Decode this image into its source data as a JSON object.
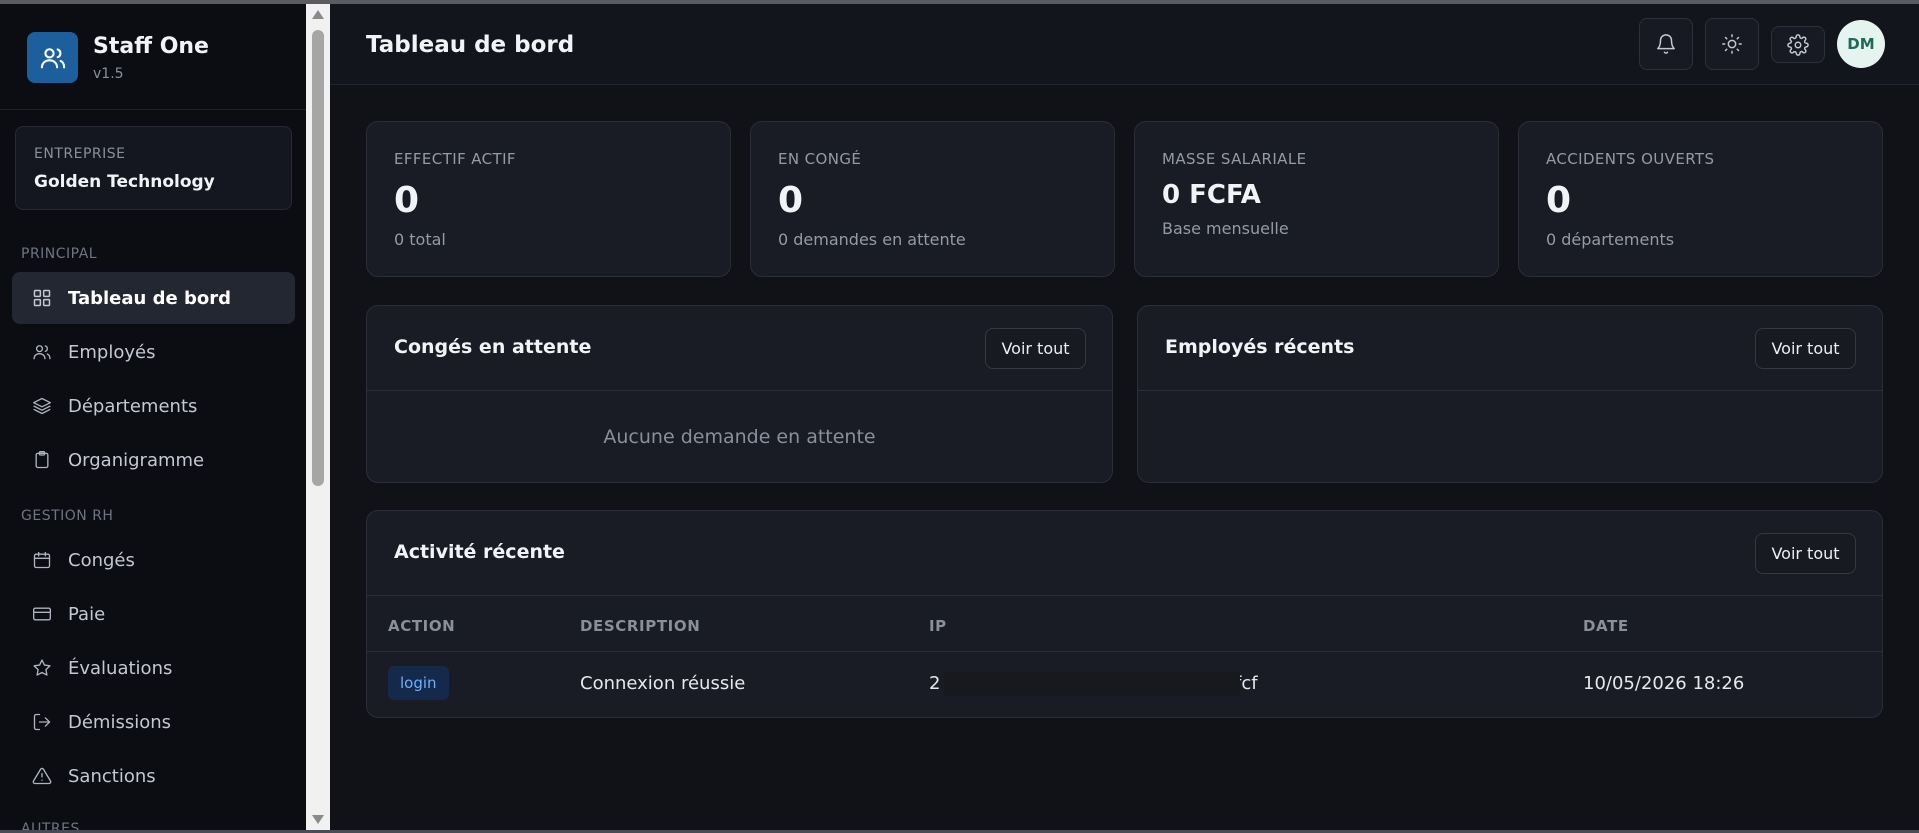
{
  "app": {
    "name": "Staff One",
    "version": "v1.5"
  },
  "company": {
    "label": "ENTREPRISE",
    "name": "Golden Technology"
  },
  "sidebar": {
    "sections": [
      {
        "label": "PRINCIPAL",
        "items": [
          {
            "label": "Tableau de bord",
            "icon": "grid-icon",
            "active": true
          },
          {
            "label": "Employés",
            "icon": "users-icon"
          },
          {
            "label": "Départements",
            "icon": "layers-icon"
          },
          {
            "label": "Organigramme",
            "icon": "clipboard-icon"
          }
        ]
      },
      {
        "label": "GESTION RH",
        "items": [
          {
            "label": "Congés",
            "icon": "calendar-icon"
          },
          {
            "label": "Paie",
            "icon": "credit-card-icon"
          },
          {
            "label": "Évaluations",
            "icon": "star-icon"
          },
          {
            "label": "Démissions",
            "icon": "logout-icon"
          },
          {
            "label": "Sanctions",
            "icon": "alert-triangle-icon"
          }
        ]
      },
      {
        "label": "AUTRES",
        "items": []
      }
    ]
  },
  "header": {
    "title": "Tableau de bord",
    "avatar_initials": "DM"
  },
  "stats": [
    {
      "label": "EFFECTIF ACTIF",
      "value": "0",
      "sub": "0 total"
    },
    {
      "label": "EN CONGÉ",
      "value": "0",
      "sub": "0 demandes en attente"
    },
    {
      "label": "MASSE SALARIALE",
      "value": "0 FCFA",
      "sub": "Base mensuelle"
    },
    {
      "label": "ACCIDENTS OUVERTS",
      "value": "0",
      "sub": "0 départements"
    }
  ],
  "panels": {
    "leaves": {
      "title": "Congés en attente",
      "button": "Voir tout",
      "empty": "Aucune demande en attente"
    },
    "recent_employees": {
      "title": "Employés récents",
      "button": "Voir tout"
    },
    "activity": {
      "title": "Activité récente",
      "button": "Voir tout"
    }
  },
  "activity_table": {
    "columns": [
      "ACTION",
      "DESCRIPTION",
      "IP",
      "DATE"
    ],
    "rows": [
      {
        "action": "login",
        "description": "Connexion réussie",
        "ip_start": "2",
        "ip_end": "fcf",
        "date": "10/05/2026 18:26"
      }
    ]
  },
  "colors": {
    "background": "#101218",
    "sidebar": "#0b0d12",
    "card": "#191c24",
    "brand": "#1d5f9c",
    "badge_text": "#6ab0ff"
  }
}
